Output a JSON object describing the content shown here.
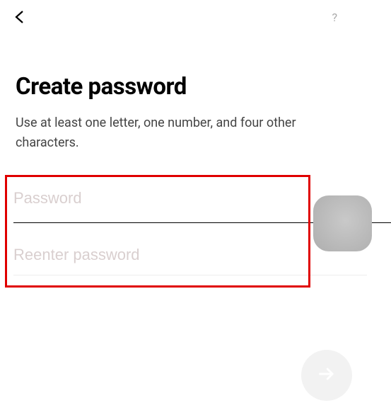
{
  "header": {
    "help_label": "?"
  },
  "page": {
    "title": "Create password",
    "subtitle": "Use at least one letter, one number, and four other characters."
  },
  "form": {
    "password_placeholder": "Password",
    "reenter_placeholder": "Reenter password"
  }
}
